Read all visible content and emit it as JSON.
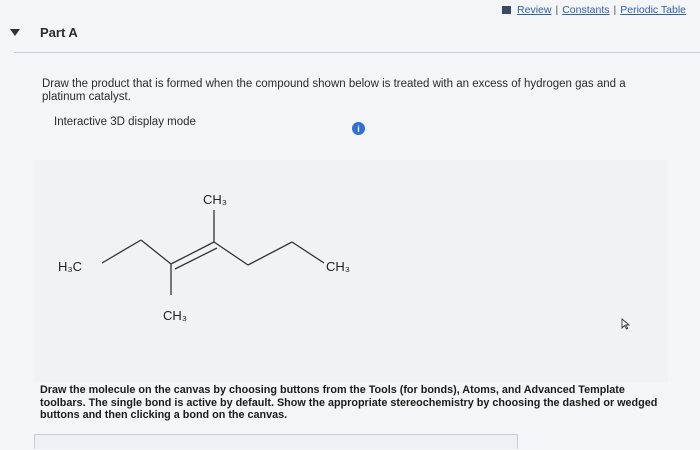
{
  "toplinks": {
    "review": "Review",
    "constants": "Constants",
    "periodic_table": "Periodic Table",
    "separator": "|"
  },
  "part": {
    "title": "Part A"
  },
  "question": {
    "text": "Draw the product that is formed when the compound shown below is treated with an excess of hydrogen gas and a platinum catalyst.",
    "display_mode": "Interactive 3D display mode",
    "info_glyph": "i"
  },
  "molecule": {
    "labels": {
      "left": "H₃C",
      "top": "CH₃",
      "bottom": "CH₃",
      "right": "CH₃"
    },
    "bond_color": "#333333"
  },
  "instructions": {
    "text": "Draw the molecule on the canvas by choosing buttons from the Tools (for bonds), Atoms, and Advanced Template toolbars. The single bond is active by default. Show the appropriate stereochemistry by choosing the dashed or wedged buttons and then clicking a bond on the canvas."
  },
  "icons": {
    "collapse": "caret-down-icon",
    "book": "book-icon",
    "info": "info-icon",
    "cursor": "cursor-icon"
  },
  "colors": {
    "link": "#2f5fa5",
    "info": "#2f6fd6"
  }
}
